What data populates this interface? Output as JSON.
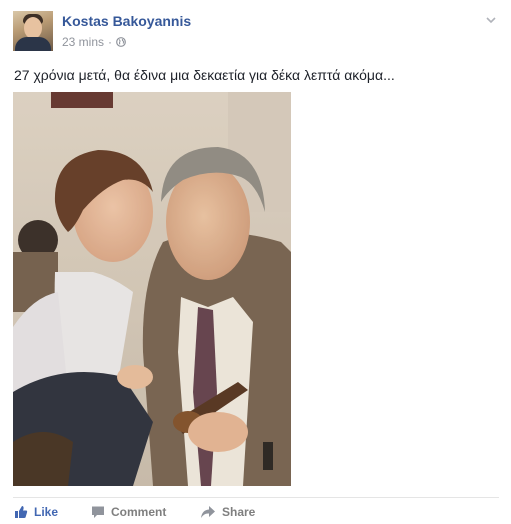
{
  "post": {
    "author": "Kostas Bakoyannis",
    "time": "23 mins",
    "separator": "·",
    "text": "27 χρόνια μετά, θα έδινα μια δεκαετία για δέκα λεπτά ακόμα..."
  },
  "actions": {
    "like": "Like",
    "comment": "Comment",
    "share": "Share"
  },
  "colors": {
    "author_link": "#365899",
    "like_blue": "#4267b2",
    "meta_gray": "#90949c"
  },
  "icons": [
    "globe-icon",
    "chevron-down-icon",
    "like-icon",
    "comment-icon",
    "share-icon"
  ]
}
